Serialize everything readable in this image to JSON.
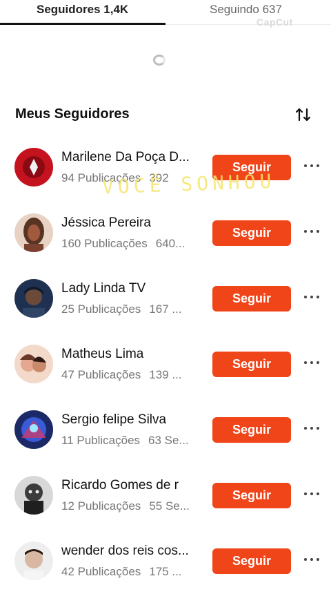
{
  "tabs": {
    "followers": "Seguidores 1,4K",
    "following": "Seguindo 637"
  },
  "watermark": "CapCut",
  "section": {
    "title": "Meus Seguidores"
  },
  "overlay_text": "VOCÊ SONHOU",
  "colors": {
    "accent": "#f04419",
    "text": "#111111",
    "muted": "#777777"
  },
  "followers": [
    {
      "name": "Marilene Da Poça D...",
      "posts": "94 Publicações",
      "extra": "392",
      "button": "Seguir",
      "avatar_color": "#c4121f"
    },
    {
      "name": "Jéssica Pereira",
      "posts": "160 Publicações",
      "extra": "640...",
      "button": "Seguir",
      "avatar_color": "#a25a3e"
    },
    {
      "name": "Lady Linda TV",
      "posts": "25 Publicações",
      "extra": "167 ...",
      "button": "Seguir",
      "avatar_color": "#1f3150"
    },
    {
      "name": "Matheus Lima",
      "posts": "47 Publicações",
      "extra": "139 ...",
      "button": "Seguir",
      "avatar_color": "#d98a76"
    },
    {
      "name": "Sergio felipe Silva",
      "posts": "11 Publicações",
      "extra": "63 Se...",
      "button": "Seguir",
      "avatar_color": "#2a3f8f"
    },
    {
      "name": "Ricardo Gomes de r",
      "posts": "12 Publicações",
      "extra": "55 Se...",
      "button": "Seguir",
      "avatar_color": "#3c3c3c"
    },
    {
      "name": "wender dos reis cos...",
      "posts": "42 Publicações",
      "extra": "175 ...",
      "button": "Seguir",
      "avatar_color": "#d9b8a3"
    }
  ]
}
